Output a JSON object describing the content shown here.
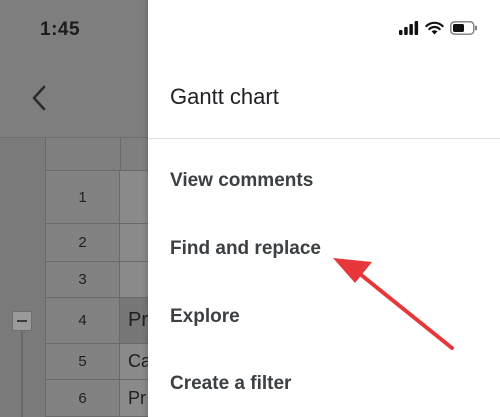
{
  "status_bar": {
    "time": "1:45"
  },
  "sheet": {
    "rows": [
      {
        "num": "1",
        "value": ""
      },
      {
        "num": "2",
        "value": ""
      },
      {
        "num": "3",
        "value": ""
      },
      {
        "num": "4",
        "value": "Pr"
      },
      {
        "num": "5",
        "value": "Ca"
      },
      {
        "num": "6",
        "value": "Pr"
      }
    ]
  },
  "drawer": {
    "title": "Gantt chart",
    "items": [
      {
        "label": "View comments"
      },
      {
        "label": "Find and replace"
      },
      {
        "label": "Explore"
      },
      {
        "label": "Create a filter"
      }
    ]
  },
  "colors": {
    "annotation_arrow": "#e8373a",
    "drawer_bg": "#ffffff",
    "overlay": "#8a8a8a"
  },
  "icons": [
    "signal-icon",
    "wifi-icon",
    "battery-icon",
    "back-chevron-icon",
    "collapse-icon"
  ]
}
